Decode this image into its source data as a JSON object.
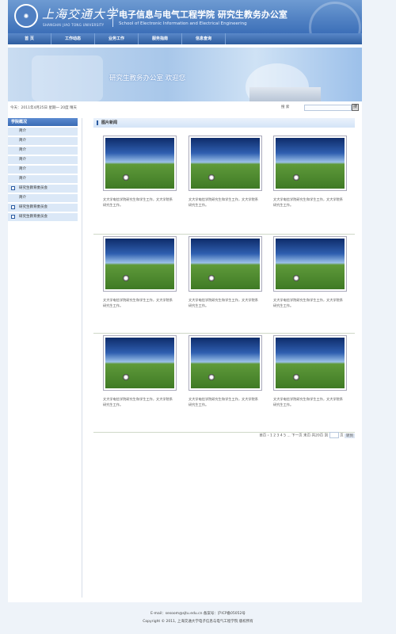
{
  "header": {
    "logo_cn": "上海交通大学",
    "logo_en": "SHANGHAI JIAO TONG UNIVERSITY",
    "title": "电子信息与电气工程学院  研究生教务办公室",
    "subtitle": "School of Electronic Information and Electrical Engineering"
  },
  "nav": [
    "首 页",
    "工作动态",
    "业务工作",
    "服务指南",
    "信息查询"
  ],
  "banner": {
    "text": "研究生教务办公室  欢迎您"
  },
  "infobar": {
    "date": "今天：2011年4月25日  星期一  20度  晴天",
    "search_label": "搜 索",
    "search_placeholder": "",
    "search_button": "搜"
  },
  "sidebar": {
    "title": "学院概况",
    "items": [
      {
        "label": "简介",
        "icon": false
      },
      {
        "label": "简介",
        "icon": false
      },
      {
        "label": "简介",
        "icon": false
      },
      {
        "label": "简介",
        "icon": false
      },
      {
        "label": "简介",
        "icon": false
      },
      {
        "label": "简介",
        "icon": false
      },
      {
        "label": "研究生教育委员会",
        "icon": true
      },
      {
        "label": "简介",
        "icon": false
      },
      {
        "label": "研究生教育委员会",
        "icon": true
      },
      {
        "label": "研究生教育委员会",
        "icon": true
      }
    ]
  },
  "main": {
    "title": "图片新闻",
    "captions": [
      "文大学电信学院研究生和学生工作，文大学院系研究生工作。",
      "文大学电信学院研究生和学生工作，文大学院系研究生工作。",
      "文大学电信学院研究生和学生工作，文大学院系研究生工作。",
      "文大学电信学院研究生和学生工作，文大学院系研究生工作。",
      "文大学电信学院研究生和学生工作，文大学院系研究生工作。",
      "文大学电信学院研究生和学生工作，文大学院系研究生工作。",
      "文大学电信学院研究生和学生工作，文大学院系研究生工作。",
      "文大学电信学院研究生和学生工作，文大学院系研究生工作。",
      "文大学电信学院研究生和学生工作，文大学院系研究生工作。"
    ],
    "pager_text": "首页 ‹ 1 2 3 4 5 ... 下一页 末页 共20页 到",
    "pager_suffix": "页",
    "pager_go": "转到"
  },
  "footer": {
    "line1": "E-mail：sesoom@sjtu.edu.cn  备案号：沪ICP备05052号",
    "line2": "Copyright © 2011, 上海交通大学电子信息与电气工程学院 版权所有"
  }
}
